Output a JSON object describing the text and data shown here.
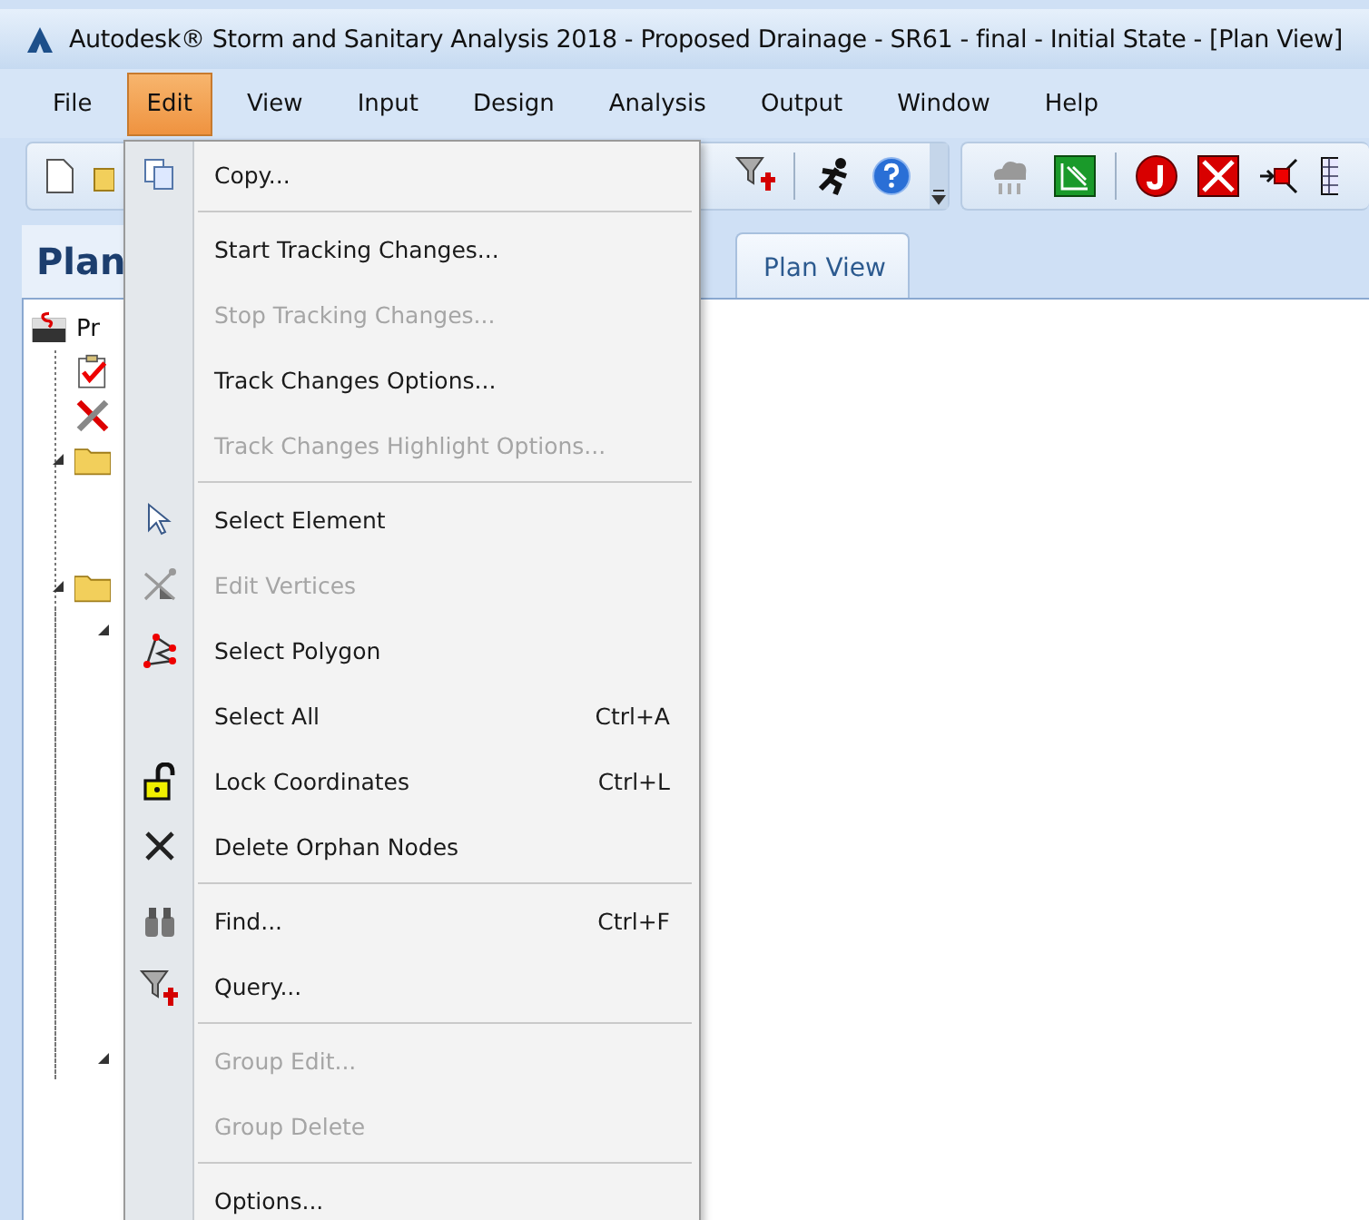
{
  "window": {
    "title": "Autodesk® Storm and Sanitary Analysis 2018 - Proposed Drainage - SR61 - final - Initial State - [Plan View]"
  },
  "menu_bar": [
    {
      "label": "File",
      "selected": false
    },
    {
      "label": "Edit",
      "selected": true
    },
    {
      "label": "View",
      "selected": false
    },
    {
      "label": "Input",
      "selected": false
    },
    {
      "label": "Design",
      "selected": false
    },
    {
      "label": "Analysis",
      "selected": false
    },
    {
      "label": "Output",
      "selected": false
    },
    {
      "label": "Window",
      "selected": false
    },
    {
      "label": "Help",
      "selected": false
    }
  ],
  "panel": {
    "title": "Plan"
  },
  "tabs": [
    {
      "label": "Plan View",
      "selected": true
    }
  ],
  "tree": [
    {
      "kind": "project",
      "label": "Pr",
      "children": [
        {
          "kind": "checklist"
        },
        {
          "kind": "tools"
        },
        {
          "kind": "folder",
          "expanded": true
        },
        {
          "kind": "folder",
          "expanded": true,
          "children": [
            {
              "expanded": true
            },
            {
              "expanded": true
            }
          ]
        }
      ]
    }
  ],
  "edit_menu": [
    {
      "kind": "item",
      "label": "Copy...",
      "disabled": false
    },
    {
      "kind": "separator"
    },
    {
      "kind": "item",
      "label": "Start Tracking Changes...",
      "disabled": false
    },
    {
      "kind": "item",
      "label": "Stop Tracking Changes...",
      "disabled": true
    },
    {
      "kind": "item",
      "label": "Track Changes Options...",
      "disabled": false
    },
    {
      "kind": "item",
      "label": "Track Changes Highlight Options...",
      "disabled": true
    },
    {
      "kind": "separator"
    },
    {
      "kind": "item",
      "label": "Select Element",
      "disabled": false
    },
    {
      "kind": "item",
      "label": "Edit Vertices",
      "disabled": true
    },
    {
      "kind": "item",
      "label": "Select Polygon",
      "disabled": false
    },
    {
      "kind": "item",
      "label": "Select All",
      "shortcut": "Ctrl+A",
      "disabled": false
    },
    {
      "kind": "item",
      "label": "Lock Coordinates",
      "shortcut": "Ctrl+L",
      "disabled": false
    },
    {
      "kind": "item",
      "label": "Delete Orphan Nodes",
      "disabled": false
    },
    {
      "kind": "separator"
    },
    {
      "kind": "item",
      "label": "Find...",
      "shortcut": "Ctrl+F",
      "disabled": false
    },
    {
      "kind": "item",
      "label": "Query...",
      "disabled": false
    },
    {
      "kind": "separator"
    },
    {
      "kind": "item",
      "label": "Group Edit...",
      "disabled": true
    },
    {
      "kind": "item",
      "label": "Group Delete",
      "disabled": true
    },
    {
      "kind": "separator"
    },
    {
      "kind": "item",
      "label": "Options...",
      "disabled": false
    }
  ]
}
